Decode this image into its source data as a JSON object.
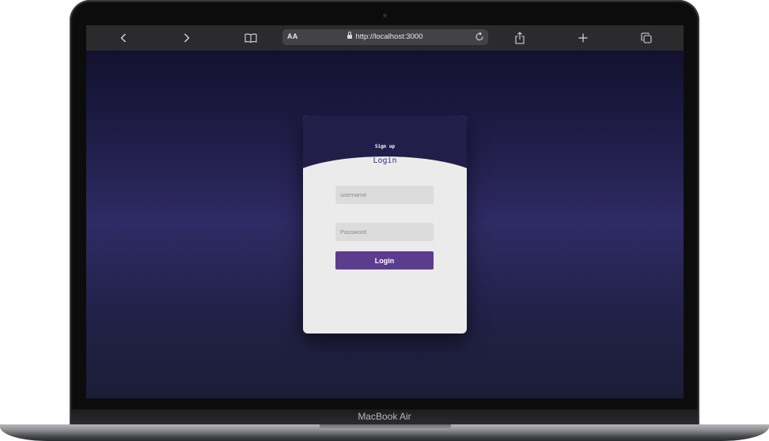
{
  "device": {
    "model": "MacBook Air"
  },
  "browser": {
    "url": "http://localhost:3000",
    "text_size_button": "AA",
    "icons": [
      "back-icon",
      "forward-icon",
      "bookmarks-icon",
      "lock-icon",
      "reload-icon",
      "share-icon",
      "new-tab-icon",
      "tabs-icon"
    ]
  },
  "page": {
    "signup_label": "Sign up",
    "login_label": "Login",
    "username_placeholder": "username",
    "password_placeholder": "Password",
    "login_button": "Login"
  },
  "colors": {
    "background_top": "#13112e",
    "background_mid": "#2f2b64",
    "card_header": "#221e4a",
    "card_body": "#ebebeb",
    "login_button": "#5b3c8e",
    "login_link": "#3a2f86"
  }
}
